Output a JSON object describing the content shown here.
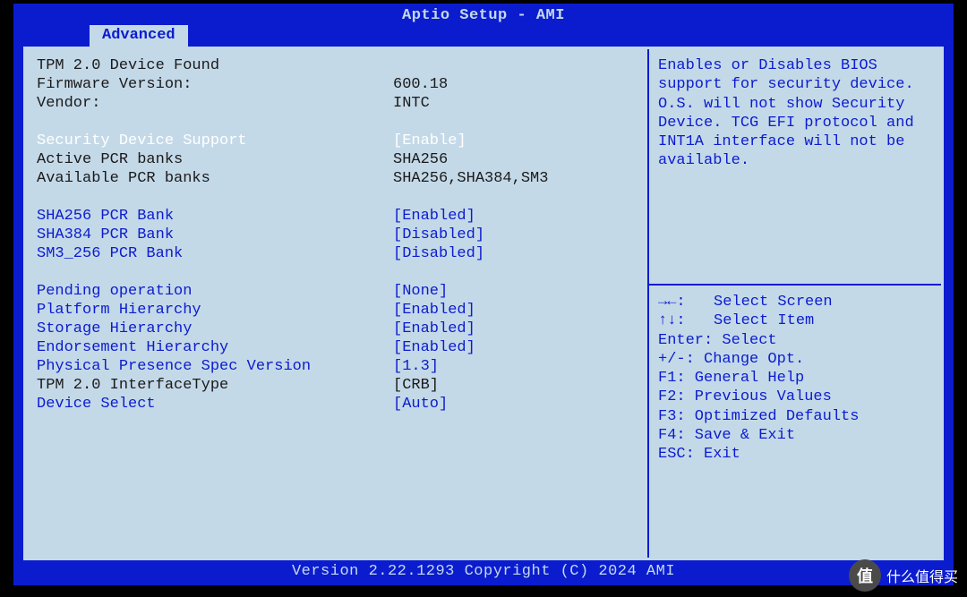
{
  "header": {
    "title": "Aptio Setup - AMI",
    "tab": "Advanced"
  },
  "left": {
    "tpm_found": "TPM 2.0 Device Found",
    "firmware_label": "Firmware Version:",
    "firmware_value": "600.18",
    "vendor_label": "Vendor:",
    "vendor_value": "INTC",
    "sec_dev_label": "Security Device Support",
    "sec_dev_value": "[Enable]",
    "active_pcr_label": "Active PCR banks",
    "active_pcr_value": "SHA256",
    "avail_pcr_label": "Available PCR banks",
    "avail_pcr_value": "SHA256,SHA384,SM3",
    "sha256_label": "SHA256 PCR Bank",
    "sha256_value": "[Enabled]",
    "sha384_label": "SHA384 PCR Bank",
    "sha384_value": "[Disabled]",
    "sm3_label": "SM3_256 PCR Bank",
    "sm3_value": "[Disabled]",
    "pending_label": "Pending operation",
    "pending_value": "[None]",
    "plat_label": "Platform Hierarchy",
    "plat_value": "[Enabled]",
    "stor_label": "Storage Hierarchy",
    "stor_value": "[Enabled]",
    "endo_label": "Endorsement Hierarchy",
    "endo_value": "[Enabled]",
    "phys_label": "Physical Presence Spec Version",
    "phys_value": "[1.3]",
    "iface_label": "TPM 2.0 InterfaceType",
    "iface_value": "[CRB]",
    "devsel_label": "Device Select",
    "devsel_value": "[Auto]"
  },
  "help": {
    "text": "Enables or Disables BIOS support for security device. O.S. will not show Security Device. TCG EFI protocol and INT1A interface will not be available."
  },
  "keys": {
    "k1": "→←:",
    "v1": "Select Screen",
    "k2": "↑↓:",
    "v2": "Select Item",
    "k3": "Enter: Select",
    "k4": "+/-: Change Opt.",
    "k5": "F1: General Help",
    "k6": "F2: Previous Values",
    "k7": "F3: Optimized Defaults",
    "k8": "F4: Save & Exit",
    "k9": "ESC: Exit"
  },
  "footer": "Version 2.22.1293 Copyright (C) 2024 AMI",
  "watermark": {
    "badge": "值",
    "text": "什么值得买"
  }
}
